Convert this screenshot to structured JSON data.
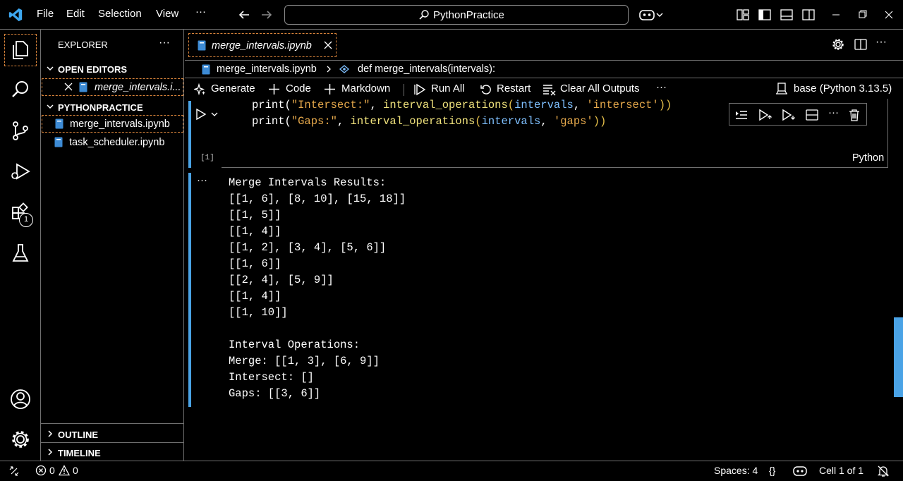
{
  "titlebar": {
    "menu": [
      "File",
      "Edit",
      "Selection",
      "View",
      "···"
    ],
    "command_center": "PythonPractice"
  },
  "activitybar": {
    "items": [
      "explorer-icon",
      "search-icon",
      "source-control-icon",
      "run-debug-icon",
      "extensions-icon",
      "testing-icon"
    ],
    "extensions_badge": "1",
    "bottom": [
      "accounts-icon",
      "manage-gear-icon"
    ]
  },
  "sidebar": {
    "title": "EXPLORER",
    "more": "···",
    "open_editors_label": "OPEN EDITORS",
    "open_editors": [
      {
        "name": "merge_intervals.i..."
      }
    ],
    "folder_label": "PYTHONPRACTICE",
    "files": [
      "merge_intervals.ipynb",
      "task_scheduler.ipynb"
    ],
    "outline_label": "OUTLINE",
    "timeline_label": "TIMELINE"
  },
  "editor": {
    "tab_label": "merge_intervals.ipynb",
    "breadcrumb_file": "merge_intervals.ipynb",
    "breadcrumb_symbol": "def merge_intervals(intervals):",
    "toolbar": {
      "generate": "Generate",
      "code": "Code",
      "markdown": "Markdown",
      "run_all": "Run All",
      "restart": "Restart",
      "clear_outputs": "Clear All Outputs",
      "more": "···",
      "kernel": "base (Python 3.13.5)"
    },
    "cell": {
      "exec_count": "[1]",
      "language": "Python",
      "code_lines": [
        {
          "pre": "print(",
          "str": "\"Intersect:\"",
          "mid": ", ",
          "fn": "interval_operations",
          "p1": "(",
          "var": "intervals",
          "sep": ", ",
          "arg": "'intersect'",
          "p2": "))"
        },
        {
          "pre": "print(",
          "str": "\"Gaps:\"",
          "mid": ", ",
          "fn": "interval_operations",
          "p1": "(",
          "var": "intervals",
          "sep": ", ",
          "arg": "'gaps'",
          "p2": "))"
        }
      ],
      "output_more": "···",
      "output_lines": [
        "Merge Intervals Results:",
        "[[1, 6], [8, 10], [15, 18]]",
        "[[1, 5]]",
        "[[1, 4]]",
        "[[1, 2], [3, 4], [5, 6]]",
        "[[1, 6]]",
        "[[2, 4], [5, 9]]",
        "[[1, 4]]",
        "[[1, 10]]",
        "",
        "Interval Operations:",
        "Merge: [[1, 3], [6, 9]]",
        "Intersect: []",
        "Gaps: [[3, 6]]"
      ]
    }
  },
  "statusbar": {
    "errors": "0",
    "warnings": "0",
    "spaces": "Spaces: 4",
    "braces": "{}",
    "cell": "Cell 1 of 1"
  }
}
